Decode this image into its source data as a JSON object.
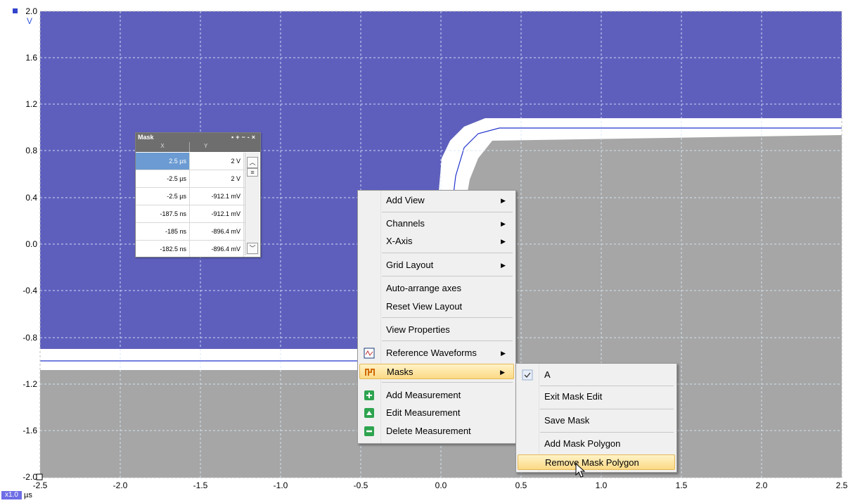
{
  "scope": {
    "y_axis": {
      "unit": "V",
      "ticks": [
        "2.0",
        "1.6",
        "1.2",
        "0.8",
        "0.4",
        "0.0",
        "-0.4",
        "-0.8",
        "-1.2",
        "-1.6",
        "-2.0"
      ]
    },
    "x_axis": {
      "unit": "µs",
      "zoom": "x1.0",
      "ticks": [
        "-2.5",
        "-2.0",
        "-1.5",
        "-1.0",
        "-0.5",
        "0.0",
        "0.5",
        "1.0",
        "1.5",
        "2.0",
        "2.5"
      ]
    },
    "colors": {
      "mask_fill": "#5e5fbd",
      "waveform": "#2233cc",
      "plot_bg": "#a6a6a6"
    }
  },
  "mask_table": {
    "title": "Mask",
    "col_x": "X",
    "col_y": "Y",
    "rows": [
      {
        "x": "2.5 µs",
        "y": "2 V"
      },
      {
        "x": "-2.5 µs",
        "y": "2 V"
      },
      {
        "x": "-2.5 µs",
        "y": "-912.1 mV"
      },
      {
        "x": "-187.5 ns",
        "y": "-912.1 mV"
      },
      {
        "x": "-185 ns",
        "y": "-896.4 mV"
      },
      {
        "x": "-182.5 ns",
        "y": "-896.4 mV"
      }
    ]
  },
  "context_menu": {
    "items": [
      {
        "label": "Add View",
        "submenu": true
      },
      {
        "label": "Channels",
        "submenu": true
      },
      {
        "label": "X-Axis",
        "submenu": true
      },
      {
        "label": "Grid Layout",
        "submenu": true
      },
      {
        "label": "Auto-arrange axes"
      },
      {
        "label": "Reset View Layout"
      },
      {
        "label": "View Properties"
      },
      {
        "label": "Reference Waveforms",
        "submenu": true,
        "icon": "reference-waveforms-icon"
      },
      {
        "label": "Masks",
        "submenu": true,
        "icon": "masks-icon",
        "highlighted": true
      },
      {
        "label": "Add Measurement",
        "icon": "add-measurement-icon"
      },
      {
        "label": "Edit Measurement",
        "icon": "edit-measurement-icon"
      },
      {
        "label": "Delete Measurement",
        "icon": "delete-measurement-icon"
      }
    ]
  },
  "masks_submenu": {
    "items": [
      {
        "label": "A",
        "checked": true
      },
      {
        "label": "Exit Mask Edit"
      },
      {
        "label": "Save Mask"
      },
      {
        "label": "Add Mask Polygon"
      },
      {
        "label": "Remove Mask Polygon",
        "highlighted": true
      }
    ]
  }
}
